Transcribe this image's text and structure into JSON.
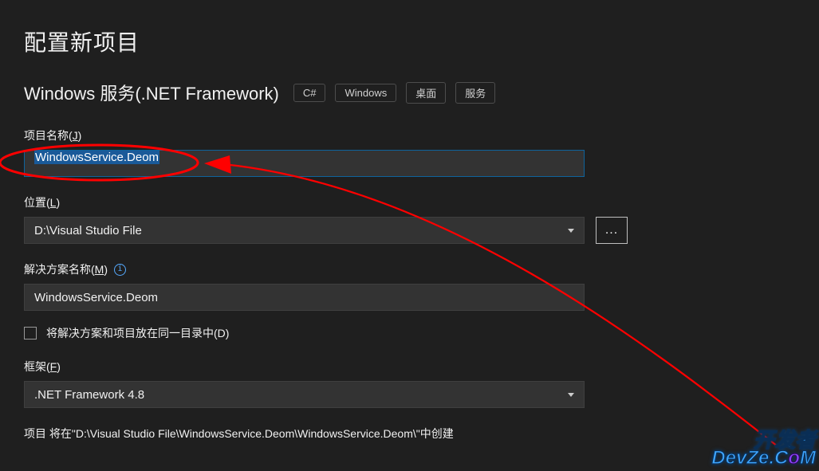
{
  "page_title": "配置新项目",
  "template": {
    "name": "Windows 服务(.NET Framework)",
    "tags": [
      "C#",
      "Windows",
      "桌面",
      "服务"
    ]
  },
  "project_name": {
    "label_prefix": "项目名称(",
    "hotkey": "J",
    "label_suffix": ")",
    "value": "WindowsService.Deom"
  },
  "location": {
    "label_prefix": "位置(",
    "hotkey": "L",
    "label_suffix": ")",
    "value": "D:\\Visual Studio File",
    "browse_label": "..."
  },
  "solution_name": {
    "label_prefix": "解决方案名称(",
    "hotkey": "M",
    "label_suffix": ")",
    "info_icon_title": "info",
    "value": "WindowsService.Deom"
  },
  "same_dir_checkbox": {
    "label_prefix": "将解决方案和项目放在同一目录中(",
    "hotkey": "D",
    "label_suffix": ")",
    "checked": false
  },
  "framework": {
    "label_prefix": "框架(",
    "hotkey": "F",
    "label_suffix": ")",
    "value": ".NET Framework 4.8"
  },
  "footer_note": "项目 将在\"D:\\Visual Studio File\\WindowsService.Deom\\WindowsService.Deom\\\"中创建",
  "watermark": {
    "line1": "开发者",
    "line2_a": "DevZe.C",
    "line2_b": "o",
    "line2_c": "M"
  }
}
